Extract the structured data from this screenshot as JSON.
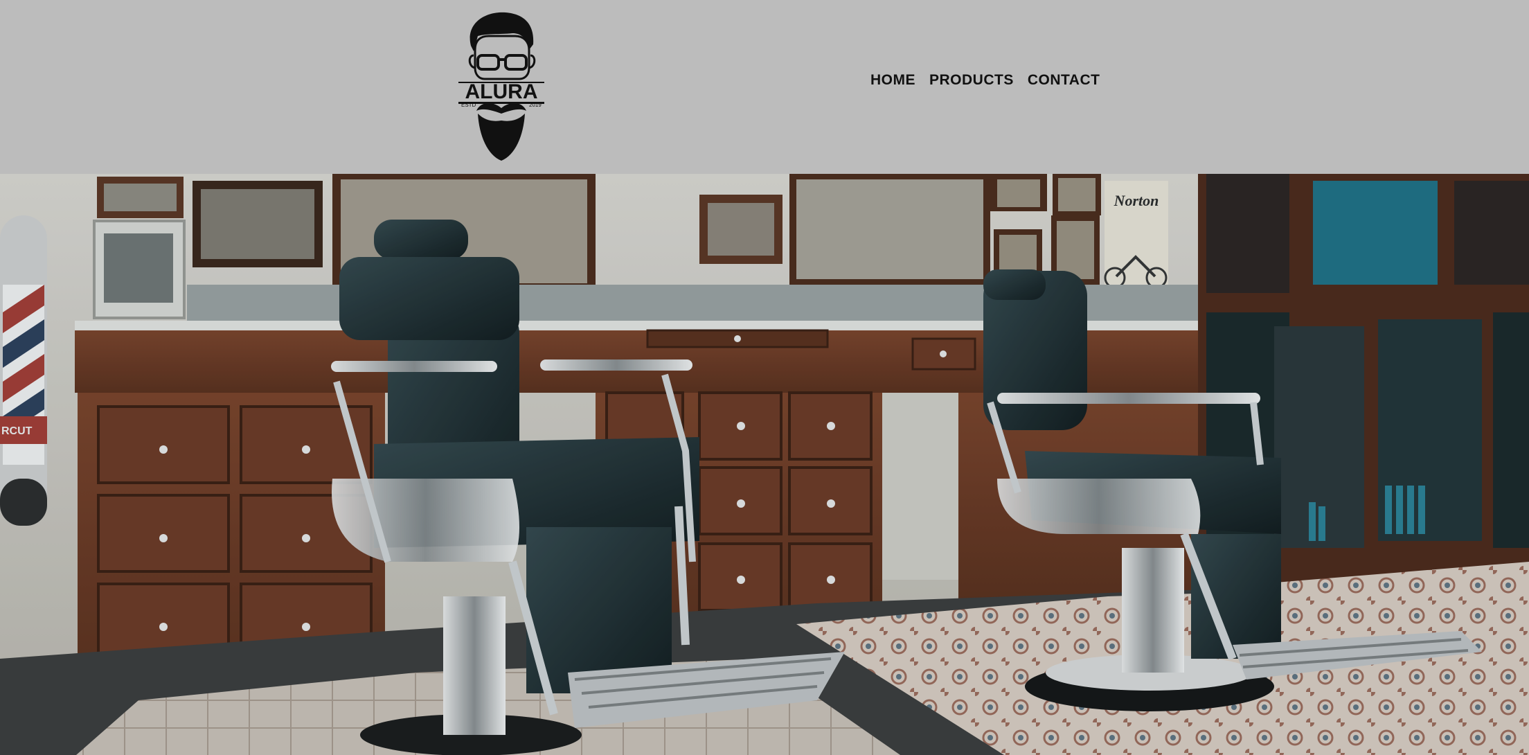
{
  "brand": {
    "name": "ALURA",
    "estd_left": "ESTD",
    "estd_right": "2019"
  },
  "nav": {
    "items": [
      {
        "label": "HOME"
      },
      {
        "label": "PRODUCTS"
      },
      {
        "label": "CONTACT"
      }
    ]
  },
  "hero": {
    "poster_text": "Norton",
    "barber_pole_text": "RCUT"
  },
  "colors": {
    "header_bg": "#bcbcbc",
    "nav_text": "#111111",
    "wood": "#6e3a22",
    "chair_leather": "#1d2a2e"
  }
}
